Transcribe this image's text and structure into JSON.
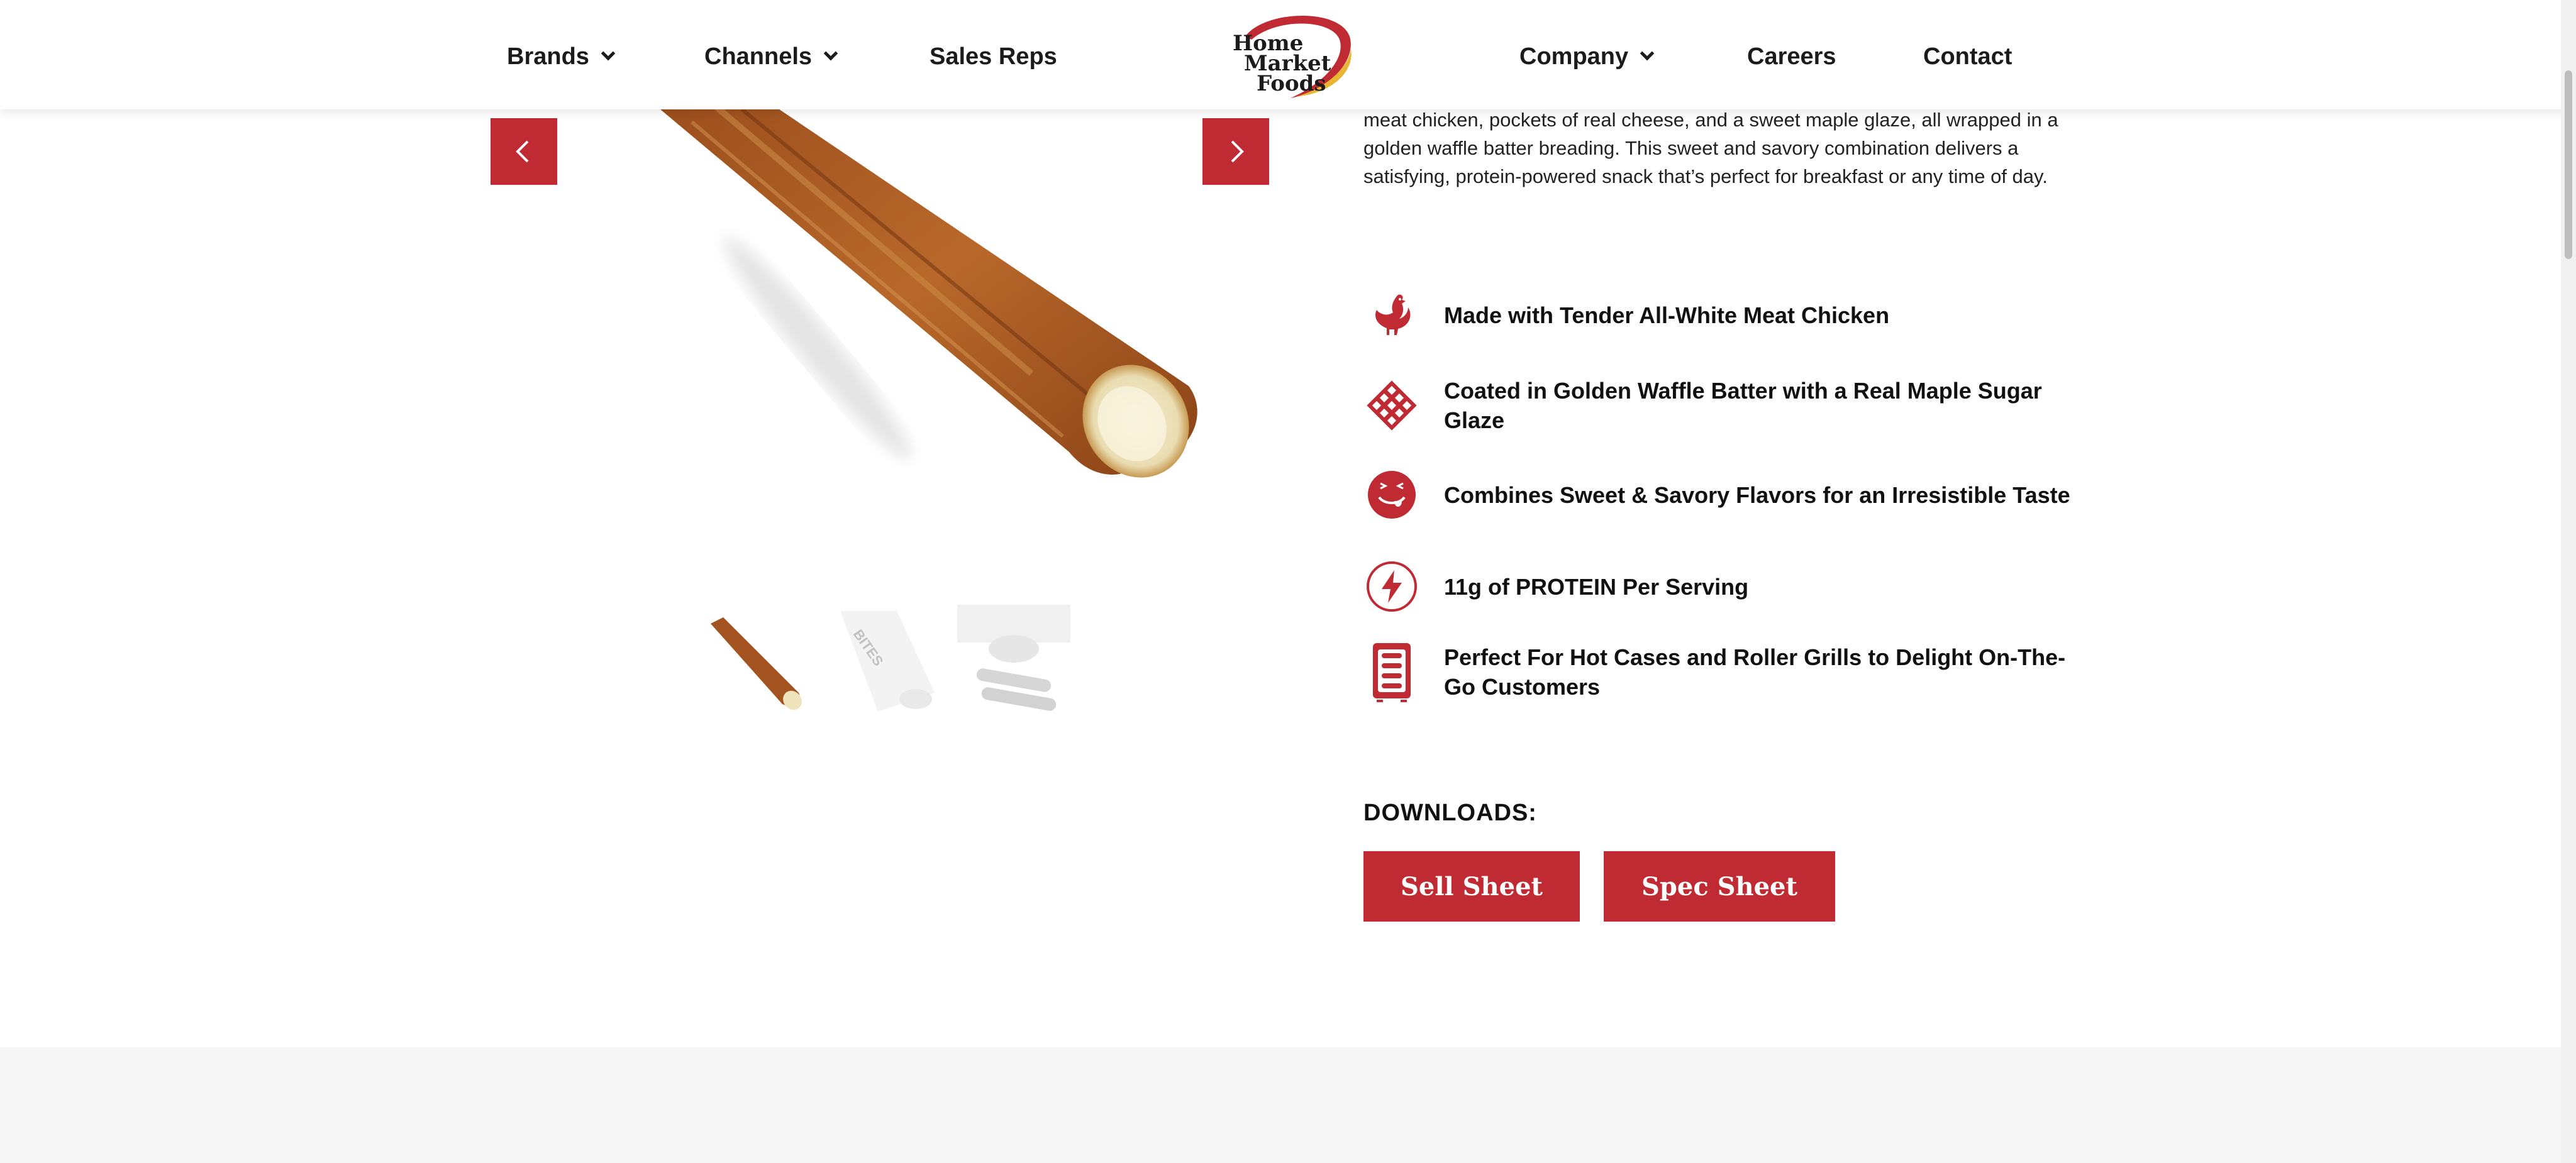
{
  "header": {
    "nav_left": [
      {
        "label": "Brands",
        "has_dropdown": true
      },
      {
        "label": "Channels",
        "has_dropdown": true
      },
      {
        "label": "Sales Reps",
        "has_dropdown": false
      }
    ],
    "nav_right": [
      {
        "label": "Company",
        "has_dropdown": true
      },
      {
        "label": "Careers",
        "has_dropdown": false
      },
      {
        "label": "Contact",
        "has_dropdown": false
      }
    ],
    "logo": {
      "line1": "Home",
      "line2": "Market",
      "line3": "Foods"
    }
  },
  "product": {
    "description": "meat chicken, pockets of real cheese, and a sweet maple glaze, all wrapped in a golden waffle batter breading. This sweet and savory combination delivers a satisfying, protein-powered snack that’s perfect for breakfast or any time of day.",
    "thumb_text": "BITES"
  },
  "features": [
    {
      "icon": "chicken-icon",
      "text": "Made with Tender All-White Meat Chicken"
    },
    {
      "icon": "waffle-icon",
      "text": "Coated in Golden Waffle Batter with a Real Maple Sugar Glaze"
    },
    {
      "icon": "tongue-smile-icon",
      "text": "Combines Sweet & Savory Flavors for an Irresistible Taste"
    },
    {
      "icon": "lightning-icon",
      "text": "11g of PROTEIN Per Serving"
    },
    {
      "icon": "roller-grill-icon",
      "text": "Perfect For Hot Cases and Roller Grills to Delight On-The-Go Customers"
    }
  ],
  "downloads": {
    "title": "DOWNLOADS:",
    "buttons": [
      {
        "label": "Sell Sheet"
      },
      {
        "label": "Spec Sheet"
      }
    ]
  },
  "colors": {
    "brand_red": "#bf2a33",
    "gold": "#e8b532",
    "band_gray": "#f6f6f6"
  }
}
